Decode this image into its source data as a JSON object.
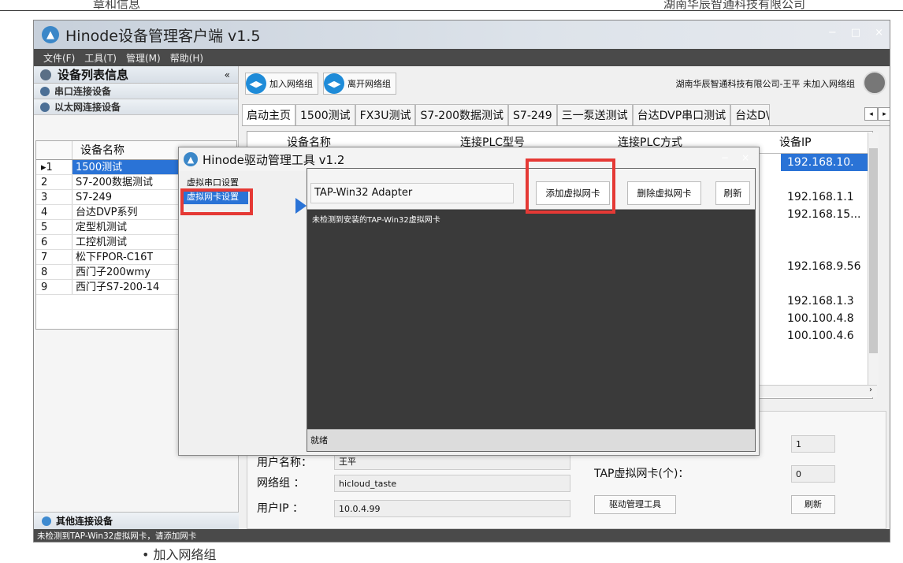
{
  "doc": {
    "header_left": "章和信息",
    "header_right": "湖南华辰智通科技有限公司",
    "footer": "•  加入网络组"
  },
  "app": {
    "title": "Hinode设备管理客户端 v1.5",
    "min": "−",
    "max": "□",
    "close": "×",
    "menu": [
      "文件(F)",
      "工具(T)",
      "管理(M)",
      "帮助(H)"
    ],
    "left": {
      "header": "设备列表信息",
      "collapse": "«",
      "sec_serial": "串口连接设备",
      "sec_eth": "以太网连接设备",
      "col": "设备名称",
      "rows": [
        {
          "n": "▸1",
          "v": "1500测试"
        },
        {
          "n": "2",
          "v": "S7-200数据测试"
        },
        {
          "n": "3",
          "v": "S7-249"
        },
        {
          "n": "4",
          "v": "台达DVP系列"
        },
        {
          "n": "5",
          "v": "定型机测试"
        },
        {
          "n": "6",
          "v": "工控机测试"
        },
        {
          "n": "7",
          "v": "松下FPOR-C16T"
        },
        {
          "n": "8",
          "v": "西门子200wmy"
        },
        {
          "n": "9",
          "v": "西门子S7-200-14"
        }
      ],
      "other": "其他连接设备"
    },
    "toolbar": {
      "join": "加入网络组",
      "leave": "离开网络组",
      "info": "湖南华辰智通科技有限公司-王平  未加入网络组"
    },
    "tabs": [
      "启动主页",
      "1500测试",
      "FX3U测试",
      "S7-200数据测试",
      "S7-249",
      "三一泵送测试",
      "台达DVP串口测试",
      "台达D\\"
    ],
    "table": {
      "h1": "设备名称",
      "h2": "连接PLC型号",
      "h3": "连接PLC方式",
      "h4": "设备IP",
      "ips": [
        "192.168.10.",
        "",
        "192.168.1.1",
        "192.168.15...",
        "",
        "",
        "192.168.9.56",
        "",
        "192.168.1.3",
        "100.100.4.8",
        "100.100.4.6"
      ]
    },
    "info": {
      "user_label": "用户名称：",
      "user": "王平",
      "group_label": "网络组 ：",
      "group": "hicloud_taste",
      "ip_label": "用户IP  ：",
      "ip": "10.0.4.99",
      "val1": "1",
      "tap_label": "TAP虚拟网卡(个)：",
      "tap": "0",
      "driver_btn": "驱动管理工具",
      "refresh": "刷新"
    },
    "status": "未检测到TAP-Win32虚拟网卡，请添加网卡"
  },
  "dialog": {
    "title": "Hinode驱动管理工具 v1.2",
    "min": "−",
    "close": "×",
    "nav": [
      "虚拟串口设置",
      "虚拟网卡设置"
    ],
    "adapter": "TAP-Win32 Adapter",
    "add": "添加虚拟网卡",
    "del": "删除虚拟网卡",
    "refresh": "刷新",
    "console": "未检测到安装的TAP-Win32虚拟网卡",
    "status": "就绪"
  },
  "colors": {
    "selection": "#2a73d6",
    "highlight": "#e53935"
  }
}
